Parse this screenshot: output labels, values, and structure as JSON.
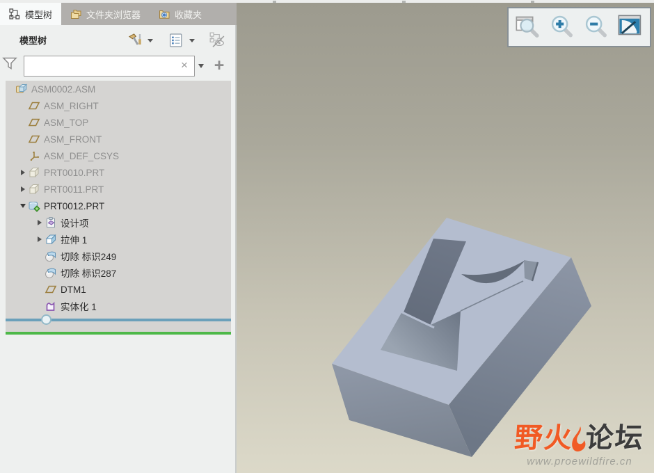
{
  "tabs": [
    {
      "label": "模型树",
      "icon": "model-tree-tab-icon",
      "active": true
    },
    {
      "label": "文件夹浏览器",
      "icon": "folder-browser-icon",
      "active": false
    },
    {
      "label": "收藏夹",
      "icon": "favorites-icon",
      "active": false
    }
  ],
  "panel": {
    "title": "模型树",
    "toolbar": [
      {
        "name": "tree-tools-button",
        "icon": "hammer-icon",
        "has_dropdown": true
      },
      {
        "name": "tree-settings-button",
        "icon": "list-settings-icon",
        "has_dropdown": true
      },
      {
        "name": "tree-display-toggle",
        "icon": "tree-hide-icon",
        "disabled": true
      }
    ],
    "filter": {
      "value": "",
      "clear_glyph": "×",
      "add_glyph": "+"
    }
  },
  "tree": {
    "items": [
      {
        "label": "ASM0002.ASM",
        "icon": "assembly-icon",
        "indent": 0,
        "arrow": null,
        "dim": true
      },
      {
        "label": "ASM_RIGHT",
        "icon": "datum-plane-icon",
        "indent": 1,
        "arrow": null,
        "dim": true
      },
      {
        "label": "ASM_TOP",
        "icon": "datum-plane-icon",
        "indent": 1,
        "arrow": null,
        "dim": true
      },
      {
        "label": "ASM_FRONT",
        "icon": "datum-plane-icon",
        "indent": 1,
        "arrow": null,
        "dim": true
      },
      {
        "label": "ASM_DEF_CSYS",
        "icon": "csys-icon",
        "indent": 1,
        "arrow": null,
        "dim": true
      },
      {
        "label": "PRT0010.PRT",
        "icon": "part-icon",
        "indent": 1,
        "arrow": "collapsed",
        "dim": true
      },
      {
        "label": "PRT0011.PRT",
        "icon": "part-icon",
        "indent": 1,
        "arrow": "collapsed",
        "dim": true
      },
      {
        "label": "PRT0012.PRT",
        "icon": "active-part-icon",
        "indent": 1,
        "arrow": "expanded",
        "dim": false
      },
      {
        "label": "设计项",
        "icon": "design-items-icon",
        "indent": 2,
        "arrow": "collapsed",
        "dim": false
      },
      {
        "label": "拉伸 1",
        "icon": "extrude-icon",
        "indent": 2,
        "arrow": "collapsed",
        "dim": false
      },
      {
        "label": "切除 标识249",
        "icon": "cut-icon",
        "indent": 2,
        "arrow": null,
        "dim": false
      },
      {
        "label": "切除 标识287",
        "icon": "cut-icon",
        "indent": 2,
        "arrow": null,
        "dim": false
      },
      {
        "label": "DTM1",
        "icon": "datum-plane-icon",
        "indent": 2,
        "arrow": null,
        "dim": false
      },
      {
        "label": "实体化 1",
        "icon": "solidify-icon",
        "indent": 2,
        "arrow": null,
        "dim": false
      }
    ]
  },
  "viewport": {
    "zoom_toolbar": [
      {
        "name": "zoom-window-button",
        "icon": "zoom-window-icon"
      },
      {
        "name": "zoom-in-button",
        "icon": "zoom-in-icon"
      },
      {
        "name": "zoom-out-button",
        "icon": "zoom-out-icon"
      },
      {
        "name": "refit-button",
        "icon": "refit-icon"
      }
    ],
    "watermark": {
      "brand_a": "野火",
      "brand_b": "论坛",
      "url": "www.proewildfire.cn"
    }
  },
  "colors": {
    "accent_orange": "#f15a24",
    "insert_line_blue": "#6ba0ba",
    "tree_end_line_green": "#4db848",
    "model_top_face": "#b4bdcf",
    "tree_background": "#d5d4d2"
  }
}
